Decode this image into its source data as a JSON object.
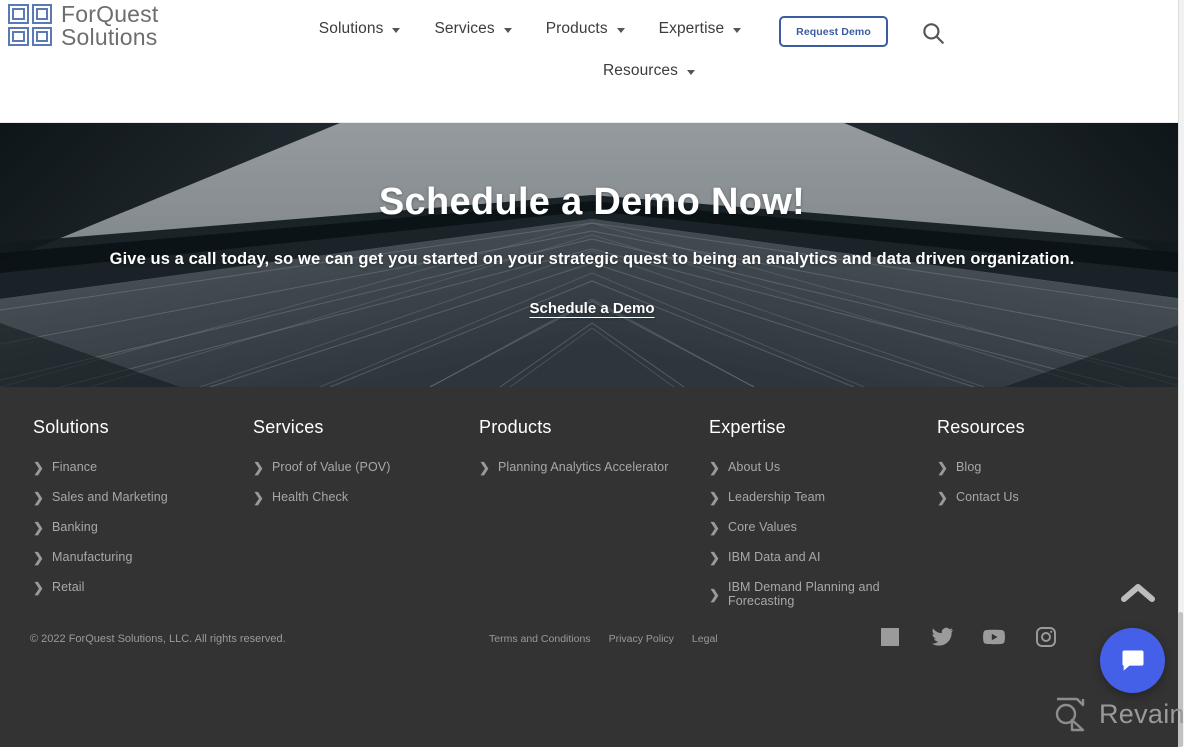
{
  "header": {
    "logo": {
      "line1": "ForQuest",
      "line2": "Solutions",
      "mark_icon": "four-squares-logo-icon",
      "color": "#5b7ab5"
    },
    "nav": {
      "row1": [
        {
          "label": "Solutions",
          "has_dropdown": true
        },
        {
          "label": "Services",
          "has_dropdown": true
        },
        {
          "label": "Products",
          "has_dropdown": true
        },
        {
          "label": "Expertise",
          "has_dropdown": true
        }
      ],
      "row2": [
        {
          "label": "Resources",
          "has_dropdown": true
        }
      ]
    },
    "request_demo_label": "Request Demo",
    "request_demo_color": "#3b5ca0",
    "search_icon": "search-icon"
  },
  "hero": {
    "title": "Schedule a Demo Now!",
    "subtitle": "Give us a call today, so we can get you started on your strategic quest to being an analytics and data driven organization.",
    "cta_label": "Schedule a Demo",
    "background": "architectural-building-perspective-photo"
  },
  "footer": {
    "columns": [
      {
        "title": "Solutions",
        "links": [
          "Finance",
          "Sales and Marketing",
          "Banking",
          "Manufacturing",
          "Retail"
        ]
      },
      {
        "title": "Services",
        "links": [
          "Proof of Value (POV)",
          "Health Check"
        ]
      },
      {
        "title": "Products",
        "links": [
          "Planning Analytics Accelerator"
        ]
      },
      {
        "title": "Expertise",
        "links": [
          "About Us",
          "Leadership Team",
          "Core Values",
          "IBM Data and AI",
          "IBM Demand Planning and Forecasting"
        ]
      },
      {
        "title": "Resources",
        "links": [
          "Blog",
          "Contact Us"
        ]
      }
    ],
    "copyright": "© 2022 ForQuest Solutions, LLC. All rights reserved.",
    "legal": [
      "Terms and Conditions",
      "Privacy Policy",
      "Legal"
    ],
    "socials": [
      {
        "name": "linkedin-icon"
      },
      {
        "name": "twitter-icon"
      },
      {
        "name": "youtube-icon"
      },
      {
        "name": "instagram-icon"
      }
    ],
    "background_color": "#333333"
  },
  "widgets": {
    "back_to_top_icon": "chevron-up-icon",
    "chat_icon": "chat-bubble-icon",
    "chat_color": "#4460e8"
  },
  "watermark": {
    "text": "Revain",
    "icon": "revain-logo-icon"
  }
}
